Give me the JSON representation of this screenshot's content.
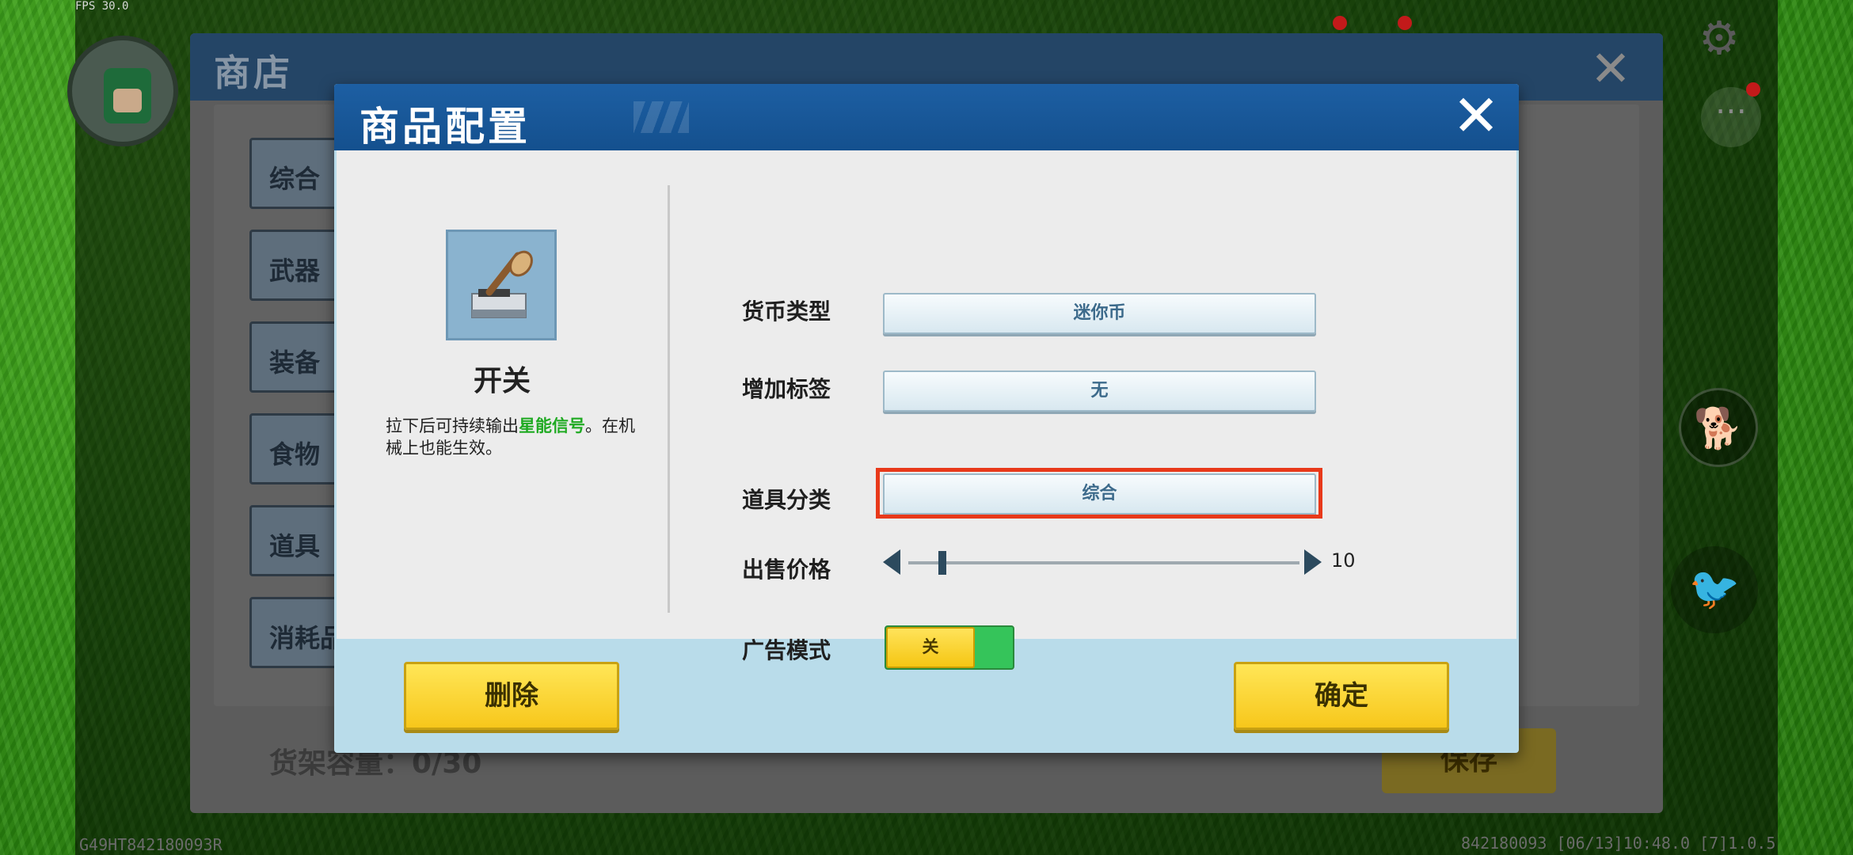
{
  "hud": {
    "fps": "FPS 30.0",
    "device_id_left": "G49HT842180093R",
    "device_id_right": "842180093   [06/13]10:48.0  [7]1.0.5"
  },
  "shop": {
    "title": "商店",
    "categories": [
      "综合",
      "武器",
      "装备",
      "食物",
      "道具",
      "消耗品"
    ],
    "capacity": "货架容量：0/30",
    "save_label": "保存"
  },
  "dialog": {
    "title": "商品配置",
    "item": {
      "icon": "lever-switch-icon",
      "name": "开关",
      "desc_part1": "拉下后可持续输出",
      "desc_highlight": "星能信号",
      "desc_part2": "。在机械上也能生效。"
    },
    "fields": {
      "currency_label": "货币类型",
      "currency_value": "迷你币",
      "tag_label": "增加标签",
      "tag_value": "无",
      "category_label": "道具分类",
      "category_value": "综合",
      "price_label": "出售价格",
      "price_value": "10",
      "ad_label": "广告模式",
      "ad_toggle_label": "关"
    },
    "delete_label": "删除",
    "confirm_label": "确定"
  },
  "colors": {
    "header_blue": "#1d5fa3",
    "highlight_red": "#e8391a",
    "button_yellow": "#f7c71b",
    "toggle_green": "#35c45a",
    "desc_highlight_green": "#1faa22"
  }
}
